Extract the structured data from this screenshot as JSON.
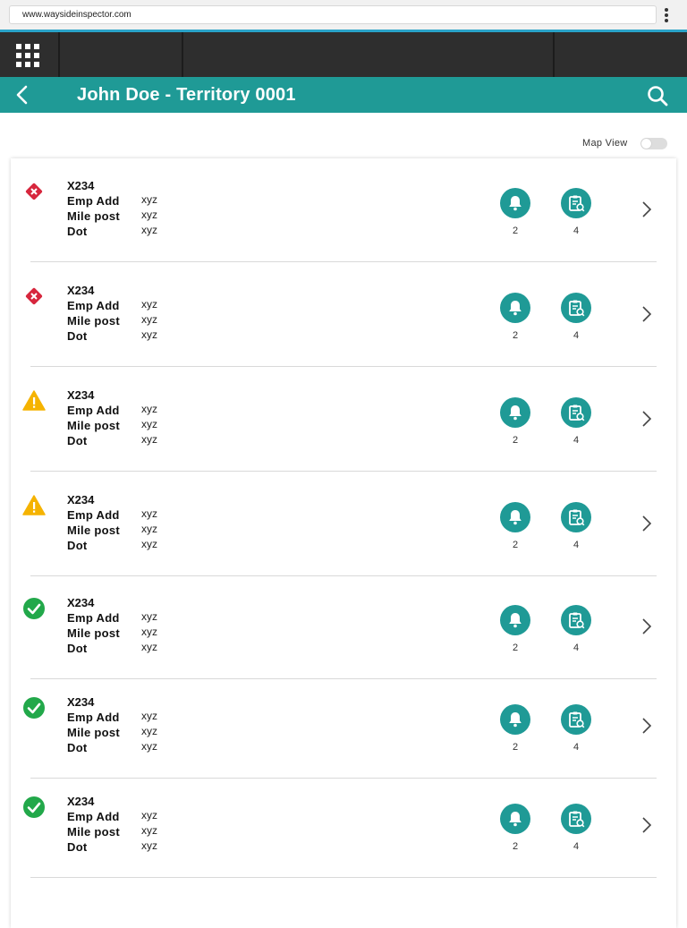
{
  "browser": {
    "url": "www.waysideinspector.com",
    "menu_icon": "kebab-menu-icon"
  },
  "header": {
    "title": "John Doe - Territory 0001",
    "back_icon": "chevron-left-icon",
    "search_icon": "search-icon",
    "apps_icon": "grid-icon",
    "color": "#1f9a96"
  },
  "map_view": {
    "label": "Map View",
    "enabled": false
  },
  "labels": {
    "emp_add": "Emp Add",
    "mile_post": "Mile post",
    "dot": "Dot"
  },
  "colors": {
    "error": "#d7263d",
    "warning": "#f5b301",
    "ok": "#22a84a",
    "teal": "#1f9a96"
  },
  "items": [
    {
      "status": "error",
      "id": "X234",
      "emp_add": "xyz",
      "mile_post": "xyz",
      "dot": "xyz",
      "alerts": "2",
      "reports": "4"
    },
    {
      "status": "error",
      "id": "X234",
      "emp_add": "xyz",
      "mile_post": "xyz",
      "dot": "xyz",
      "alerts": "2",
      "reports": "4"
    },
    {
      "status": "warning",
      "id": "X234",
      "emp_add": "xyz",
      "mile_post": "xyz",
      "dot": "xyz",
      "alerts": "2",
      "reports": "4"
    },
    {
      "status": "warning",
      "id": "X234",
      "emp_add": "xyz",
      "mile_post": "xyz",
      "dot": "xyz",
      "alerts": "2",
      "reports": "4"
    },
    {
      "status": "ok",
      "id": "X234",
      "emp_add": "xyz",
      "mile_post": "xyz",
      "dot": "xyz",
      "alerts": "2",
      "reports": "4"
    },
    {
      "status": "ok",
      "id": "X234",
      "emp_add": "xyz",
      "mile_post": "xyz",
      "dot": "xyz",
      "alerts": "2",
      "reports": "4"
    },
    {
      "status": "ok",
      "id": "X234",
      "emp_add": "xyz",
      "mile_post": "xyz",
      "dot": "xyz",
      "alerts": "2",
      "reports": "4"
    }
  ]
}
